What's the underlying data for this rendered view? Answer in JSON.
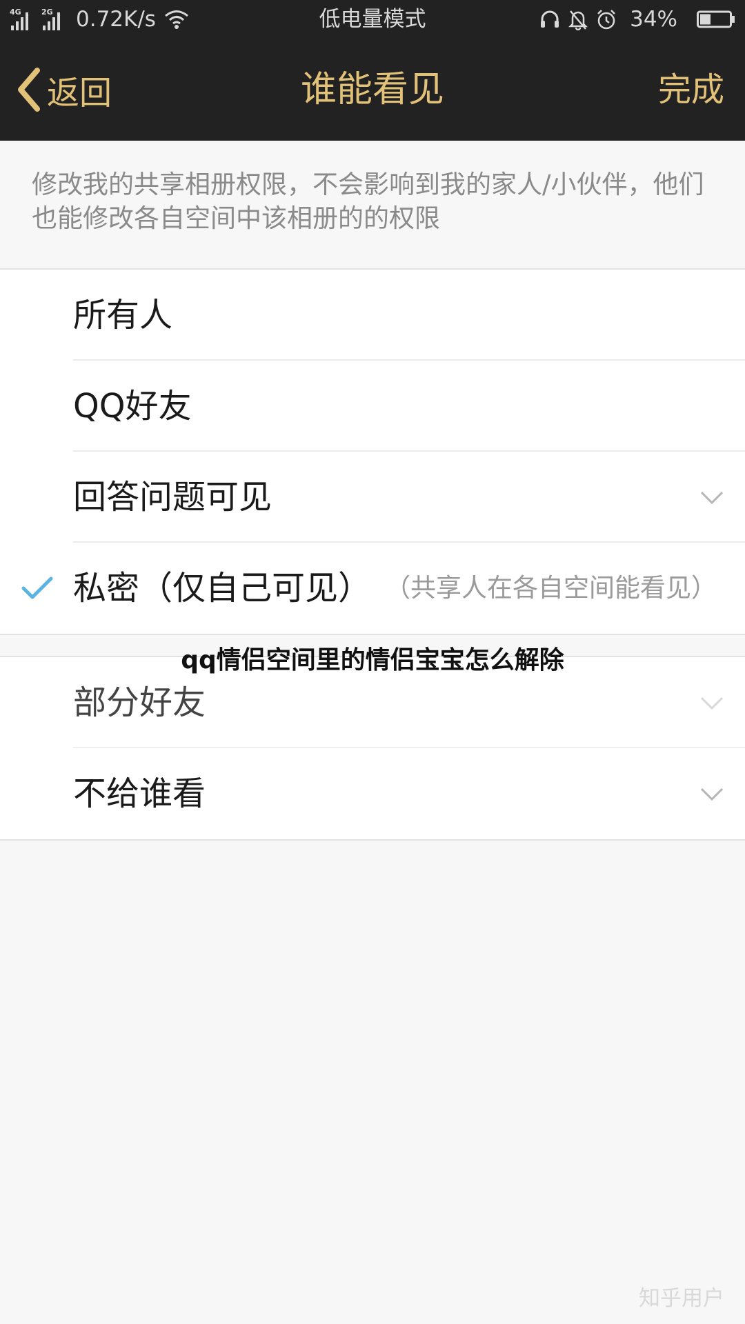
{
  "status_bar": {
    "network_1": "4G",
    "network_2": "2G",
    "speed": "0.72K/s",
    "center_text": "低电量模式",
    "battery": "34%",
    "icons": [
      "headset-icon",
      "bell-icon",
      "alarm-icon",
      "battery-icon",
      "wifi-icon"
    ]
  },
  "nav": {
    "back_label": "返回",
    "title": "谁能看见",
    "done_label": "完成",
    "accent_color": "#e2c178"
  },
  "description": "修改我的共享相册权限，不会影响到我的家人/小伙伴，他们也能修改各自空间中该相册的的权限",
  "options": [
    {
      "label": "所有人",
      "selected": false,
      "has_chevron": false
    },
    {
      "label": "QQ好友",
      "selected": false,
      "has_chevron": false
    },
    {
      "label": "回答问题可见",
      "selected": false,
      "has_chevron": true
    },
    {
      "label": "私密（仅自己可见）",
      "note": "（共享人在各自空间能看见）",
      "selected": true,
      "has_chevron": false
    },
    {
      "label": "部分好友",
      "selected": false,
      "has_chevron": true
    },
    {
      "label": "不给谁看",
      "selected": false,
      "has_chevron": true
    }
  ],
  "check_color": "#5ab4e0",
  "overlay_caption": "qq情侣空间里的情侣宝宝怎么解除",
  "watermark": "知乎用户"
}
